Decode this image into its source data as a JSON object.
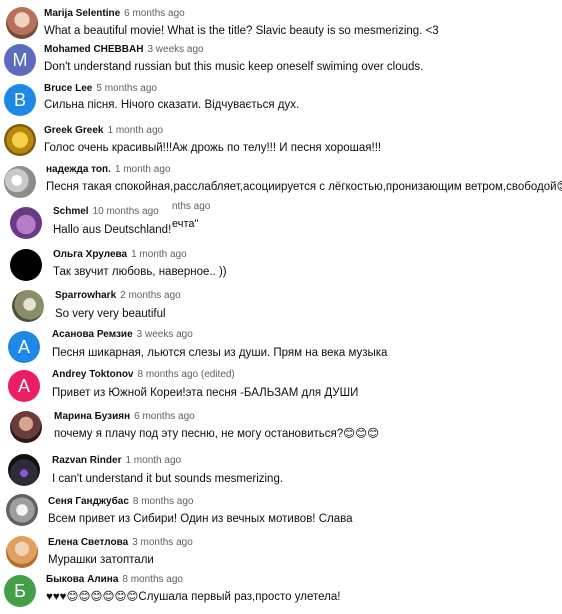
{
  "comments": [
    {
      "author": "Marija Selentine",
      "time": "6 months ago",
      "text": "What a beautiful movie! What is the title? Slavic beauty is so mesmerizing.  <3",
      "initial": "",
      "avatar_color": "#c98f7a",
      "avatar_kind": "photo-woman"
    },
    {
      "author": "Mohamed CHEBBAH",
      "time": "3 weeks ago",
      "text": "Don't understand russian but this music keep oneself swiming over clouds.",
      "initial": "M",
      "avatar_color": "#5c6bc0",
      "avatar_kind": "letter"
    },
    {
      "author": "Bruce Lee",
      "time": "5 months ago",
      "text": "Сильна пісня. Нічого сказати. Відчувається дух.",
      "initial": "B",
      "avatar_color": "#1e88e5",
      "avatar_kind": "letter"
    },
    {
      "author": "Greek Greek",
      "time": "1 month ago",
      "text": "Голос очень красивый!!!Аж дрожь по телу!!! И песня хорошая!!!",
      "initial": "",
      "avatar_color": "#d4a017",
      "avatar_kind": "emblem"
    },
    {
      "author": "надежда топ.",
      "time": "1 month ago",
      "text": "Песня такая спокойная,расслабляет,асоциируется с лёгкостью,пронизающим ветром,свободой😊☁",
      "initial": "",
      "avatar_color": "#d9d9d9",
      "avatar_kind": "photo-flower"
    },
    {
      "author": "Schmel",
      "time": "10 months ago",
      "text": "Hallo aus Deutschland!",
      "initial": "",
      "avatar_color": "#7b4fa0",
      "avatar_kind": "photo-purple"
    },
    {
      "author": "Ольга Хрулева",
      "time": "1 month ago",
      "text": "Так звучит любовь, наверное.. ))",
      "initial": "",
      "avatar_color": "#000000",
      "avatar_kind": "dark"
    },
    {
      "author": "Sparrowhark",
      "time": "2 months ago",
      "text": "So very very beautiful",
      "initial": "",
      "avatar_color": "#8a8d6a",
      "avatar_kind": "photo-bird"
    },
    {
      "author": "Асанова Ремзие",
      "time": "3 weeks ago",
      "text": "Песня шикарная, льются слезы из души. Прям на века музыка",
      "initial": "A",
      "avatar_color": "#1e88e5",
      "avatar_kind": "letter"
    },
    {
      "author": "Andrey Toktonov",
      "time": "8 months ago (edited)",
      "text": "Привет из Южной Кореи!эта песня -БАЛЬЗАМ для ДУШИ",
      "initial": "A",
      "avatar_color": "#e91e63",
      "avatar_kind": "letter"
    },
    {
      "author": "Марина Бузиян",
      "time": "6 months ago",
      "text": "почему я плачу под эту песню, не могу остановиться?😊😊😊",
      "initial": "",
      "avatar_color": "#6a3b3b",
      "avatar_kind": "photo-woman2"
    },
    {
      "author": "Razvan Rinder",
      "time": "1 month ago",
      "text": "I can't understand it but sounds mesmerizing.",
      "initial": "",
      "avatar_color": "#2b2b3a",
      "avatar_kind": "photo-city"
    },
    {
      "author": "Сеня Ганджубас",
      "time": "8 months ago",
      "text": "Всем привет из Сибири! Один из вечных мотивов! Слава",
      "initial": "",
      "avatar_color": "#bdbdbd",
      "avatar_kind": "photo-grey"
    },
    {
      "author": "Елена Светлова",
      "time": "3 months ago",
      "text": "Мурашки затоптали",
      "initial": "",
      "avatar_color": "#e0a060",
      "avatar_kind": "photo-woman3"
    },
    {
      "author": "Быкова Алина",
      "time": "8 months ago",
      "text": "♥♥♥😊😊😊😊😊😊Слушала первый раз,просто улетела!",
      "initial": "Б",
      "avatar_color": "#43a047",
      "avatar_kind": "letter"
    }
  ],
  "overlap_fragments": {
    "fragment_1": "nths ago",
    "fragment_2": "ечта\""
  }
}
